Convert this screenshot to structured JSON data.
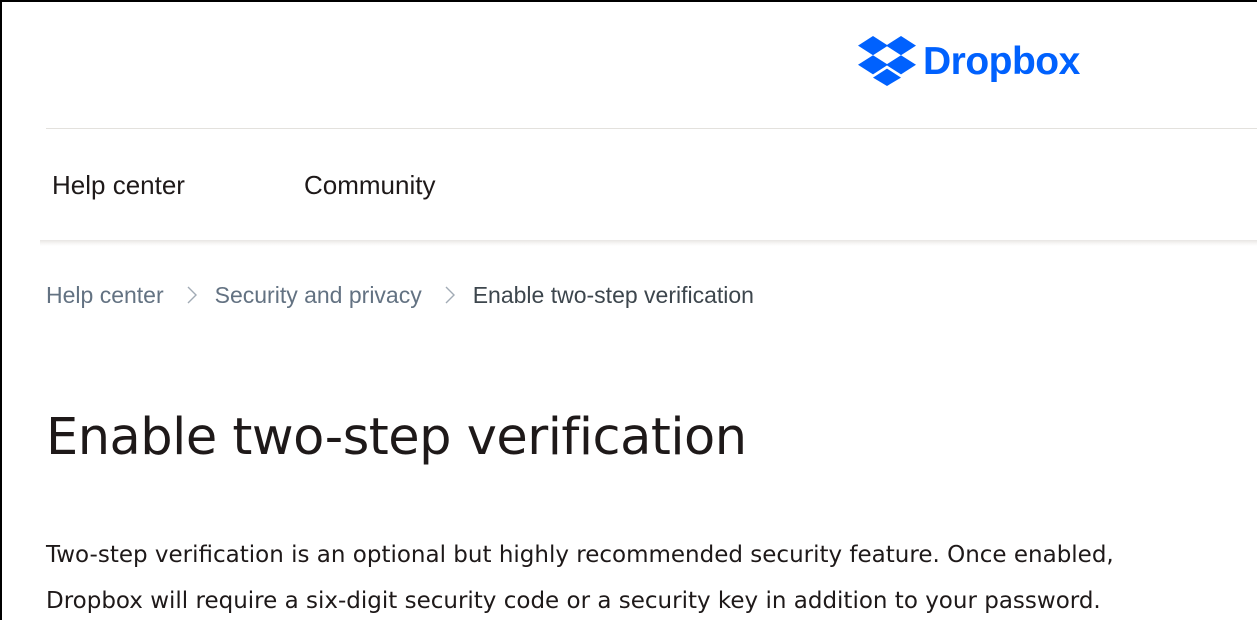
{
  "brand": {
    "name": "Dropbox",
    "logo_icon": "dropbox-box-icon",
    "color": "#0061fe"
  },
  "nav": {
    "tabs": [
      {
        "label": "Help center",
        "active": true
      },
      {
        "label": "Community",
        "active": false
      }
    ]
  },
  "breadcrumb": {
    "items": [
      "Help center",
      "Security and privacy",
      "Enable two-step verification"
    ],
    "separator_icon": "chevron-right-icon"
  },
  "article": {
    "title": "Enable two-step verification",
    "intro_lines": [
      "Two-step verification is an optional but highly recommended security feature. Once enabled,",
      "Dropbox will require a six-digit security code or a security key in addition to your password."
    ]
  },
  "colors": {
    "accent": "#0061fe",
    "text": "#1e1919",
    "muted": "#637282"
  }
}
